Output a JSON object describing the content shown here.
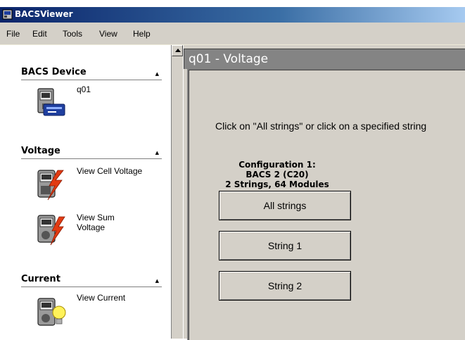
{
  "window": {
    "title": "BACSViewer"
  },
  "menu": {
    "items": [
      "File",
      "Edit",
      "Tools",
      "View",
      "Help"
    ]
  },
  "sidebar": {
    "sections": [
      {
        "title": "BACS Device",
        "items": [
          {
            "label": "q01",
            "icon": "bacs-device-icon"
          }
        ]
      },
      {
        "title": "Voltage",
        "items": [
          {
            "label": "View Cell Voltage",
            "icon": "cell-voltage-icon"
          },
          {
            "label": "View Sum Voltage",
            "icon": "sum-voltage-icon"
          }
        ]
      },
      {
        "title": "Current",
        "items": [
          {
            "label": "View Current",
            "icon": "current-icon"
          }
        ]
      }
    ]
  },
  "main": {
    "header": "q01 - Voltage",
    "instruction": "Click on \"All strings\" or click on a specified string",
    "config": {
      "line1": "Configuration 1:",
      "line2": "BACS 2 (C20)",
      "line3": "2 Strings, 64 Modules"
    },
    "buttons": [
      "All strings",
      "String 1",
      "String 2"
    ]
  },
  "colors": {
    "title_bar": "#0a246a",
    "panel_header": "#848484",
    "face": "#d4d0c8"
  }
}
